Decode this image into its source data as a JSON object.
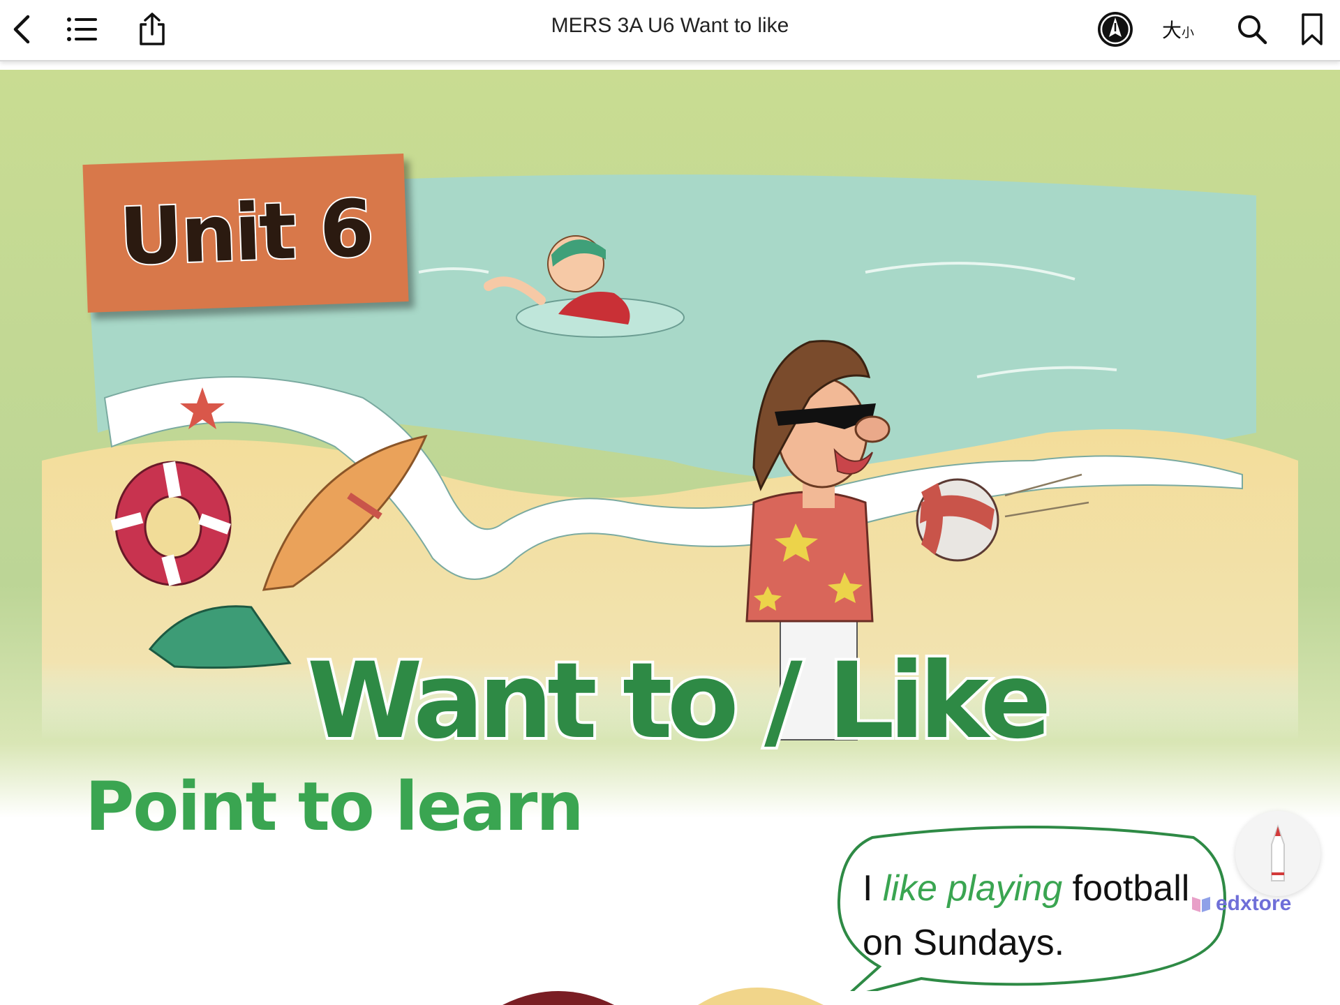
{
  "toolbar": {
    "title": "MERS 3A U6 Want to like",
    "size_label_big": "大",
    "size_label_small": "小",
    "icons": {
      "back": "chevron-left-icon",
      "toc": "list-icon",
      "share": "share-icon",
      "annotate": "pen-circle-icon",
      "search": "search-icon",
      "bookmark": "bookmark-icon"
    }
  },
  "page": {
    "unit_tag": "Unit 6",
    "main_title": "Want to / Like",
    "section_heading": "Point to learn",
    "speech": {
      "before": "I ",
      "highlight": "like playing",
      "after": " football on Sundays."
    }
  },
  "floating": {
    "pen_button_icon": "pencil-icon"
  },
  "watermark": {
    "text": "edxtore"
  },
  "colors": {
    "title_green": "#2e8a45",
    "heading_green": "#3aa551",
    "unit_tag_orange": "#d8784a",
    "sea": "#a8d8c8",
    "sand": "#f1dc98",
    "watermark": "#6f6fd8"
  }
}
